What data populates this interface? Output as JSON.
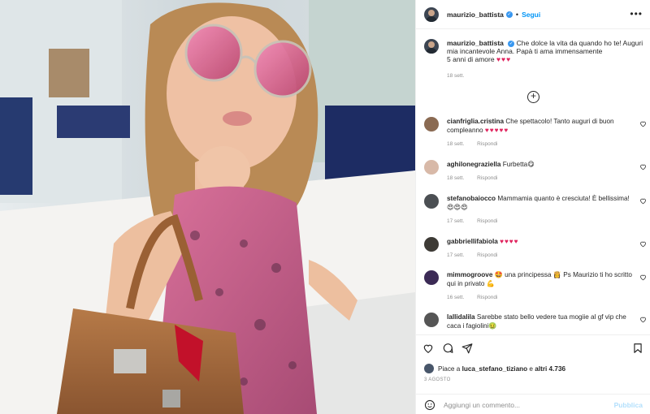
{
  "post": {
    "username": "maurizio_battista",
    "follow_label": "Segui",
    "more_label": "•••",
    "caption_user": "maurizio_battista",
    "caption_text": "Che dolce la vita da quando ho te! Auguri mia incantevole Anna. Papà ti ama immensamente",
    "caption_line2": "5 anni di amore",
    "caption_hearts": "♥♥♥",
    "caption_time": "18 sett.",
    "load_more_label": "+"
  },
  "comments": [
    {
      "user": "cianfriglia.cristina",
      "text": "Che spettacolo! Tanto auguri di buon compleanno",
      "hearts": "♥♥♥♥♥",
      "time": "18 sett.",
      "reply": "Rispondi",
      "avatar_color": "#8a6a52"
    },
    {
      "user": "aghilonegraziella",
      "text": "Furbetta😋",
      "hearts": "",
      "time": "18 sett.",
      "reply": "Rispondi",
      "avatar_color": "#d8b9a8"
    },
    {
      "user": "stefanobaiocco",
      "text": "Mammamia quanto è cresciuta! È bellissima! 😍😍😍",
      "hearts": "",
      "time": "17 sett.",
      "reply": "Rispondi",
      "avatar_color": "#4b4f53"
    },
    {
      "user": "gabbriellifabiola",
      "text": "",
      "hearts": "♥♥♥♥",
      "time": "17 sett.",
      "reply": "Rispondi",
      "avatar_color": "#3d3a35"
    },
    {
      "user": "mimmogroove",
      "text": "🤩 una principessa 👸 Ps Maurizio ti ho scritto qui in privato 💪",
      "hearts": "",
      "time": "16 sett.",
      "reply": "Rispondi",
      "avatar_color": "#3b2a55"
    },
    {
      "user": "lallidalila",
      "text": "Sarebbe stato bello vedere tua mogiie al gf vip che caca i fagiolini🤢",
      "hearts": "",
      "time": "",
      "reply": "",
      "avatar_color": "#555555"
    }
  ],
  "actions": {
    "likes_prefix": "Piace a ",
    "likes_user": "luca_stefano_tiziano",
    "likes_mid": " e ",
    "likes_count": "altri 4.736",
    "date": "3 AGOSTO",
    "comment_placeholder": "Aggiungi un commento...",
    "post_label": "Pubblica"
  },
  "icons": {
    "heart": "heart-icon",
    "comment": "comment-icon",
    "share": "share-icon",
    "save": "bookmark-icon",
    "emoji": "emoji-icon"
  },
  "colors": {
    "accent": "#0095f6",
    "heart_red": "#e0245e",
    "muted": "#8e8e8e"
  }
}
